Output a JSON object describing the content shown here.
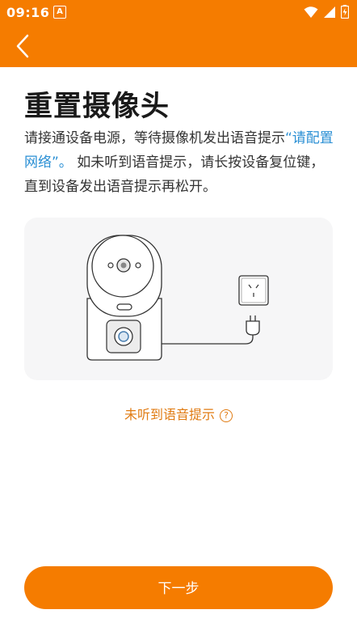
{
  "status_bar": {
    "time": "09:16",
    "notification_icon": "A",
    "icons": [
      "wifi-icon",
      "signal-icon",
      "battery-icon"
    ]
  },
  "header": {
    "back_icon": "chevron-left-icon"
  },
  "page": {
    "title": "重置摄像头",
    "desc_part1": "请接通设备电源，等待摄像机发出语音提示",
    "desc_highlight": "“请配置网络”。",
    "desc_part2": " 如未听到语音提示，请长按设备复位键，直到设备发出语音提示再松开。"
  },
  "help": {
    "label": "未听到语音提示",
    "icon_glyph": "?"
  },
  "next_button": {
    "label": "下一步"
  },
  "colors": {
    "accent": "#f57c00",
    "link": "#2a8fd4",
    "help_text": "#e07b12"
  }
}
